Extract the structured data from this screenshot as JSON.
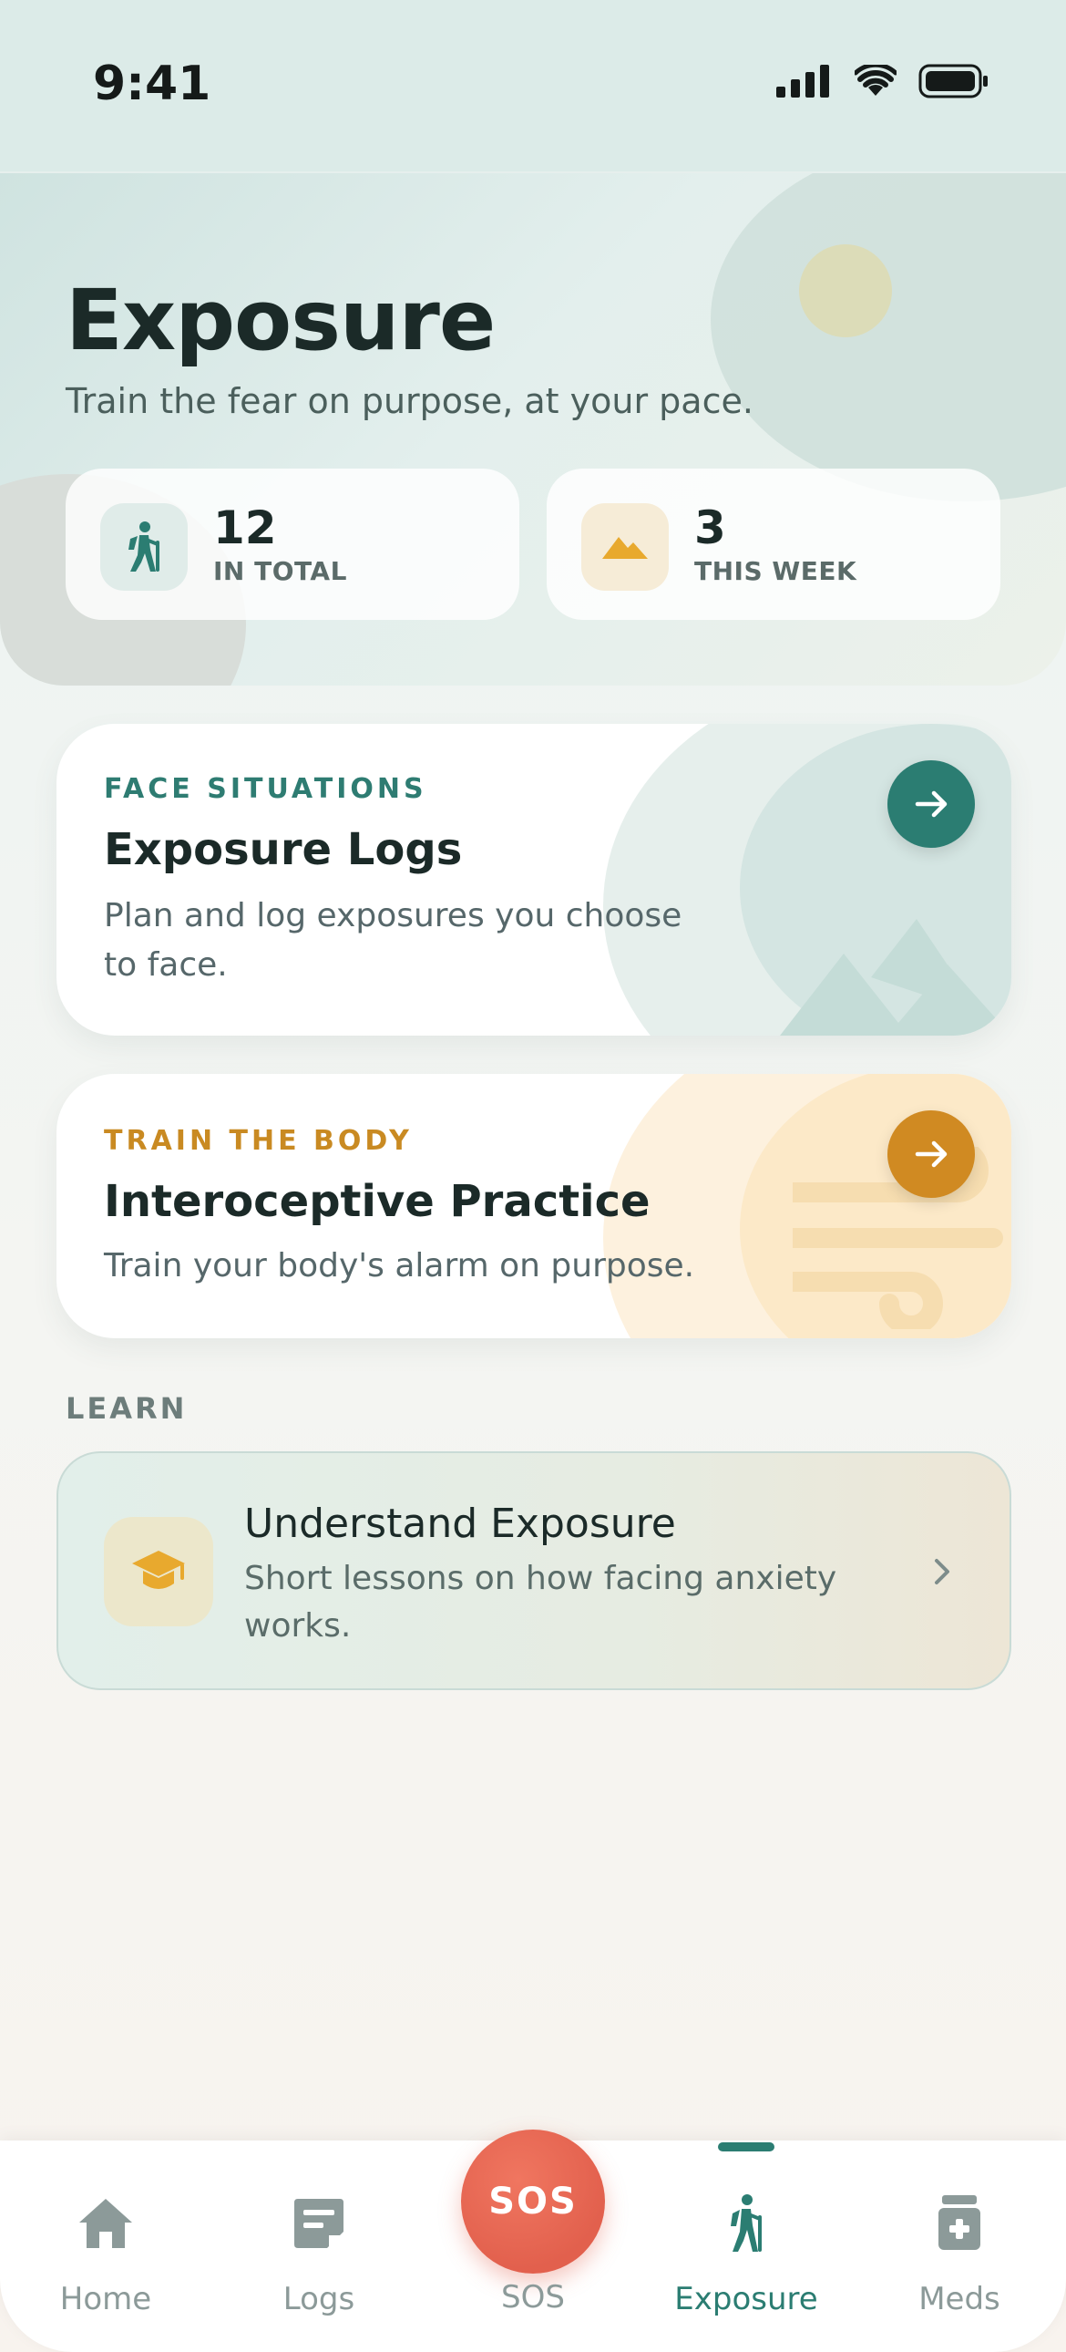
{
  "status_bar": {
    "time": "9:41"
  },
  "header": {
    "title": "Exposure",
    "subtitle": "Train the fear on purpose, at your pace."
  },
  "stats": [
    {
      "value": "12",
      "label": "IN TOTAL",
      "icon": "hiking-icon",
      "accent": "#2b7d72"
    },
    {
      "value": "3",
      "label": "THIS WEEK",
      "icon": "mountain-icon",
      "accent": "#e8a92e"
    }
  ],
  "cards": {
    "exposure_logs": {
      "eyebrow": "FACE SITUATIONS",
      "title": "Exposure Logs",
      "description": "Plan and log exposures you choose to face.",
      "accent": "#2b7d72"
    },
    "interoceptive": {
      "eyebrow": "TRAIN THE BODY",
      "title": "Interoceptive Practice",
      "description": "Train your body's alarm on purpose.",
      "accent": "#d08a22"
    }
  },
  "learn": {
    "section_label": "LEARN",
    "title": "Understand Exposure",
    "description": "Short lessons on how facing anxiety works.",
    "icon": "graduation-cap-icon"
  },
  "nav": {
    "home": "Home",
    "logs": "Logs",
    "sos_button": "SOS",
    "sos_label": "SOS",
    "exposure": "Exposure",
    "meds": "Meds",
    "active": "Exposure"
  }
}
